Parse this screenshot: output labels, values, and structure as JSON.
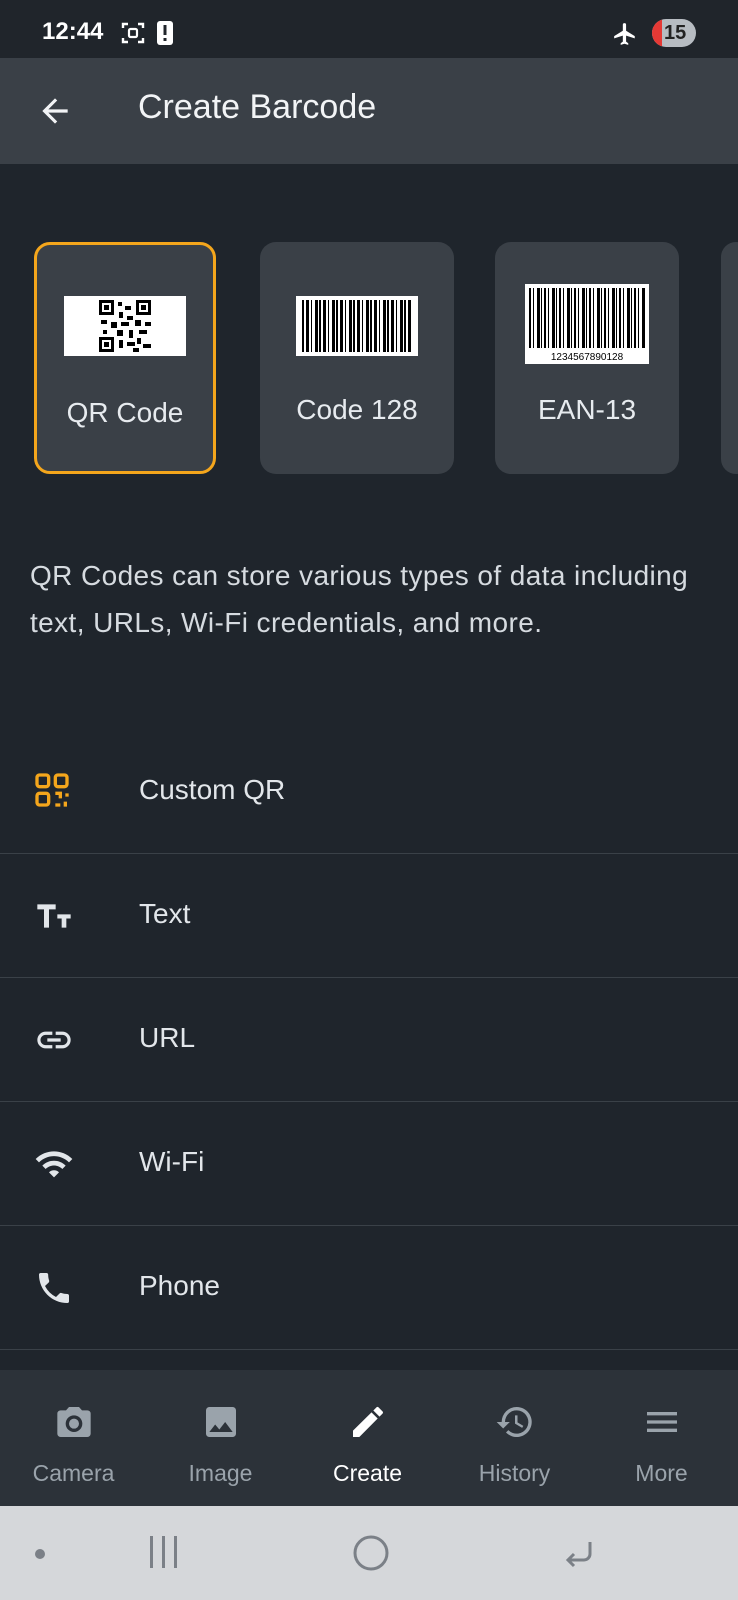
{
  "status_bar": {
    "time": "12:44",
    "notification_count": "15"
  },
  "app_bar": {
    "title": "Create Barcode"
  },
  "barcode_types": [
    {
      "label": "QR Code",
      "selected": true
    },
    {
      "label": "Code 128",
      "selected": false
    },
    {
      "label": "EAN-13",
      "selected": false,
      "sample_digits": "1234567890128"
    }
  ],
  "description": "QR Codes can store various types of data including text, URLs, Wi-Fi credentials, and more.",
  "content_types": [
    {
      "label": "Custom QR",
      "icon": "qr-icon"
    },
    {
      "label": "Text",
      "icon": "text-fields-icon"
    },
    {
      "label": "URL",
      "icon": "link-icon"
    },
    {
      "label": "Wi-Fi",
      "icon": "wifi-icon"
    },
    {
      "label": "Phone",
      "icon": "phone-icon"
    }
  ],
  "bottom_nav": {
    "camera": "Camera",
    "image": "Image",
    "create": "Create",
    "history": "History",
    "more": "More"
  },
  "colors": {
    "background": "#1f252c",
    "app_bar": "#3a4047",
    "accent": "#f4a61c",
    "bottom_nav": "#2c3239"
  }
}
